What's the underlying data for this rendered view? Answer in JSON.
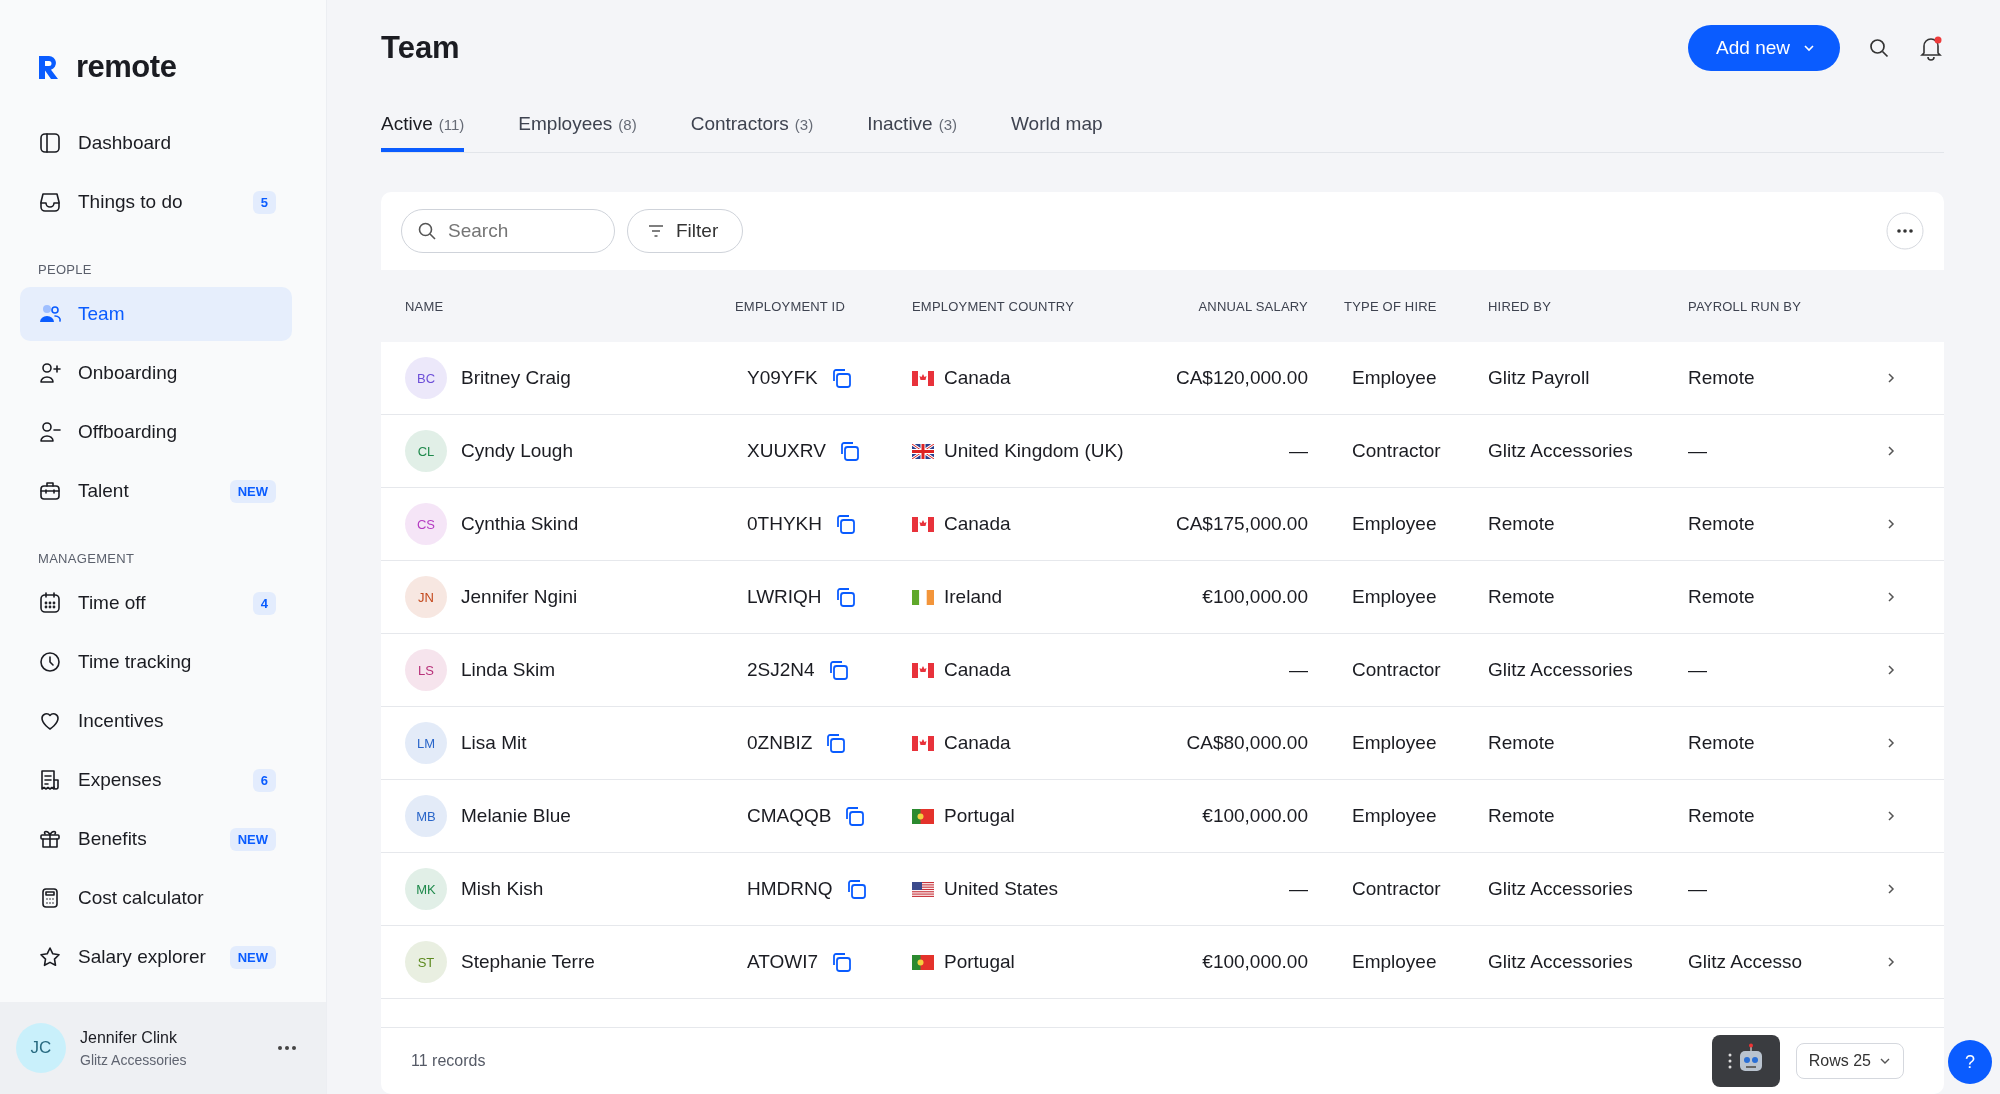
{
  "brand": {
    "name": "remote"
  },
  "sidebar": {
    "sections": [
      {
        "items": [
          {
            "label": "Dashboard",
            "selected": false
          },
          {
            "label": "Things to do",
            "badge": "5",
            "selected": false
          }
        ]
      },
      {
        "heading": "PEOPLE",
        "items": [
          {
            "label": "Team",
            "selected": true
          },
          {
            "label": "Onboarding",
            "selected": false
          },
          {
            "label": "Offboarding",
            "selected": false
          },
          {
            "label": "Talent",
            "badge": "NEW",
            "selected": false
          }
        ]
      },
      {
        "heading": "MANAGEMENT",
        "items": [
          {
            "label": "Time off",
            "badge": "4",
            "selected": false
          },
          {
            "label": "Time tracking",
            "selected": false
          },
          {
            "label": "Incentives",
            "selected": false
          },
          {
            "label": "Expenses",
            "badge": "6",
            "selected": false
          },
          {
            "label": "Benefits",
            "badge": "NEW",
            "selected": false
          },
          {
            "label": "Cost calculator",
            "selected": false
          },
          {
            "label": "Salary explorer",
            "badge": "NEW",
            "selected": false
          }
        ]
      }
    ],
    "user": {
      "initials": "JC",
      "name": "Jennifer Clink",
      "company": "Glitz Accessories"
    }
  },
  "page": {
    "title": "Team",
    "add_button": "Add new"
  },
  "tabs": [
    {
      "label": "Active",
      "count": "(11)",
      "selected": true
    },
    {
      "label": "Employees",
      "count": "(8)",
      "selected": false
    },
    {
      "label": "Contractors",
      "count": "(3)",
      "selected": false
    },
    {
      "label": "Inactive",
      "count": "(3)",
      "selected": false
    },
    {
      "label": "World map",
      "selected": false
    }
  ],
  "toolbar": {
    "search_placeholder": "Search",
    "filter": "Filter"
  },
  "table": {
    "columns": [
      "NAME",
      "EMPLOYMENT ID",
      "EMPLOYMENT COUNTRY",
      "ANNUAL SALARY",
      "TYPE OF HIRE",
      "HIRED BY",
      "PAYROLL RUN BY"
    ],
    "rows": [
      {
        "initials": "BC",
        "color": "#6d4fd8",
        "name": "Britney Craig",
        "id": "Y09YFK",
        "country": "Canada",
        "kind": "ca",
        "salary": "CA$120,000.00",
        "type": "Employee",
        "hired_by": "Glitz Payroll",
        "payroll": "Remote"
      },
      {
        "initials": "CL",
        "color": "#1f8a4c",
        "name": "Cyndy Lough",
        "id": "XUUXRV",
        "country": "United Kingdom (UK)",
        "kind": "uk",
        "salary": "—",
        "type": "Contractor",
        "hired_by": "Glitz Accessories",
        "payroll": "—"
      },
      {
        "initials": "CS",
        "color": "#b43bc2",
        "name": "Cynthia Skind",
        "id": "0THYKH",
        "country": "Canada",
        "kind": "ca",
        "salary": "CA$175,000.00",
        "type": "Employee",
        "hired_by": "Remote",
        "payroll": "Remote"
      },
      {
        "initials": "JN",
        "color": "#c4481c",
        "name": "Jennifer Ngini",
        "id": "LWRIQH",
        "country": "Ireland",
        "kind": "ie",
        "salary": "€100,000.00",
        "type": "Employee",
        "hired_by": "Remote",
        "payroll": "Remote"
      },
      {
        "initials": "LS",
        "color": "#b8327a",
        "name": "Linda Skim",
        "id": "2SJ2N4",
        "country": "Canada",
        "kind": "ca",
        "salary": "—",
        "type": "Contractor",
        "hired_by": "Glitz Accessories",
        "payroll": "—"
      },
      {
        "initials": "LM",
        "color": "#2a66c9",
        "name": "Lisa Mit",
        "id": "0ZNBIZ",
        "country": "Canada",
        "kind": "ca",
        "salary": "CA$80,000.00",
        "type": "Employee",
        "hired_by": "Remote",
        "payroll": "Remote"
      },
      {
        "initials": "MB",
        "color": "#2a66c9",
        "name": "Melanie Blue",
        "id": "CMAQQB",
        "country": "Portugal",
        "kind": "pt",
        "salary": "€100,000.00",
        "type": "Employee",
        "hired_by": "Remote",
        "payroll": "Remote"
      },
      {
        "initials": "MK",
        "color": "#1f8a4c",
        "name": "Mish Kish",
        "id": "HMDRNQ",
        "country": "United States",
        "kind": "us",
        "salary": "—",
        "type": "Contractor",
        "hired_by": "Glitz Accessories",
        "payroll": "—"
      },
      {
        "initials": "ST",
        "color": "#5d8a1f",
        "name": "Stephanie Terre",
        "id": "ATOWI7",
        "country": "Portugal",
        "kind": "pt",
        "salary": "€100,000.00",
        "type": "Employee",
        "hired_by": "Glitz Accessories",
        "payroll": "Glitz Accesso"
      }
    ]
  },
  "footer": {
    "records": "11 records",
    "rows_label": "Rows 25"
  },
  "help_button": "?"
}
